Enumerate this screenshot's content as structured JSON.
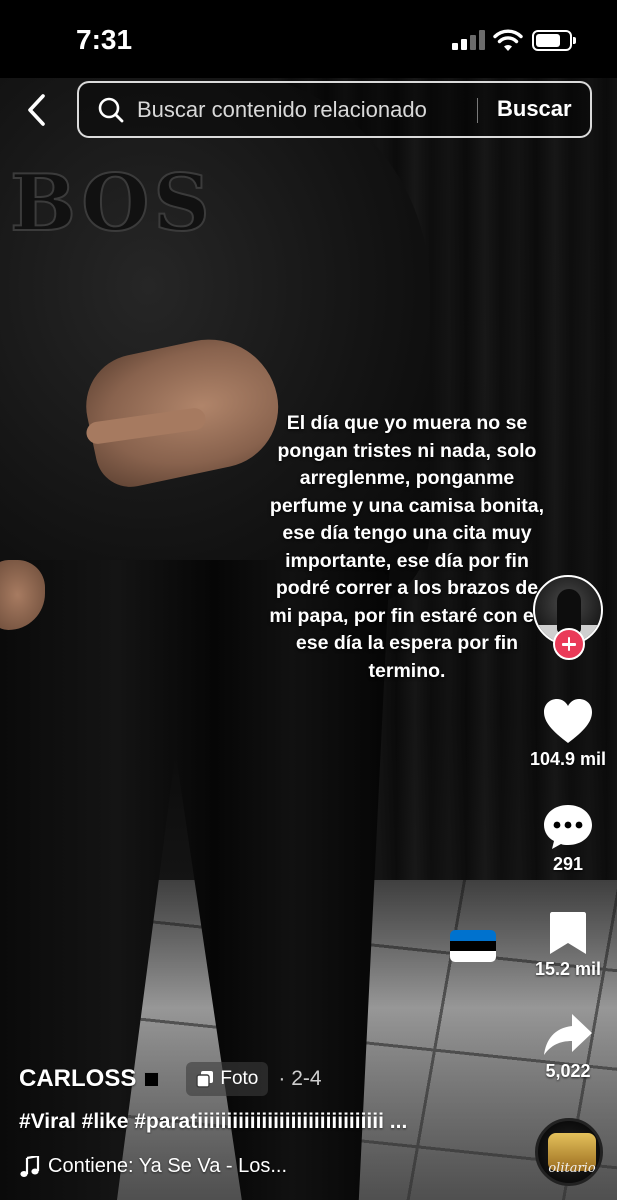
{
  "status_bar": {
    "time": "7:31",
    "signal_bars_active": 2,
    "signal_bars_total": 4,
    "battery_level": 0.75
  },
  "header": {
    "back_icon": "chevron-left-icon",
    "search": {
      "placeholder": "Buscar contenido relacionado",
      "value": "",
      "icon": "search-icon",
      "submit_label": "Buscar"
    }
  },
  "post": {
    "overlay_text": "El día que yo muera no se pongan tristes ni nada, solo arreglenme, ponganme perfume y una camisa bonita, ese día tengo una cita muy importante, ese día por fin podré correr a los brazos de mi papa, por fin estaré con el, ese día la espera por fin termino.",
    "photo_print": "BOS",
    "flag_colors": [
      "#0072CE",
      "#000000",
      "#FFFFFF"
    ]
  },
  "actions": {
    "like": {
      "icon": "heart-icon",
      "count": "104.9 mil"
    },
    "comment": {
      "icon": "comment-bubble-icon",
      "count": "291"
    },
    "save": {
      "icon": "bookmark-icon",
      "count": "15.2 mil"
    },
    "share": {
      "icon": "share-arrow-icon",
      "count": "5,022"
    },
    "follow_icon": "plus-icon"
  },
  "author": {
    "username": "CARLOSS",
    "badge_icon": "photo-stack-icon",
    "badge_label": "Foto",
    "date": "· 2-4"
  },
  "caption": {
    "hashtags": "#Viral #like #paratiiiiiiiiiiiiiiiiiiiiiiiiiiiiiiii ..."
  },
  "music": {
    "icon": "music-note-icon",
    "label": "Contiene: Ya Se Va - Los...",
    "disc_text": "olitario"
  },
  "colors": {
    "accent_red": "#EA3A58",
    "text": "#FFFFFF"
  }
}
